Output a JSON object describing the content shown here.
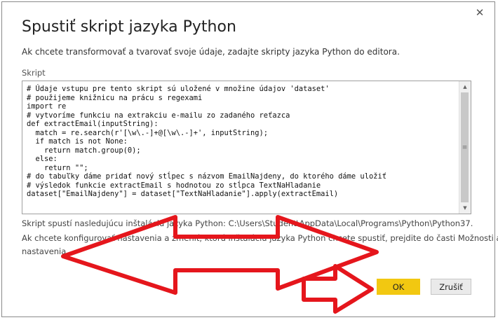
{
  "dialog": {
    "title": "Spustiť skript jazyka Python",
    "subtitle": "Ak chcete transformovať a tvarovať svoje údaje, zadajte skripty jazyka Python do editora.",
    "script_label": "Skript",
    "code_lines": [
      "# Údaje vstupu pre tento skript sú uložené v množine údajov 'dataset'",
      "# použijeme knižnicu na prácu s regexami",
      "import re",
      "# vytvoríme funkciu na extrakciu e-mailu zo zadaného reťazca",
      "def extractEmail(inputString):",
      "  match = re.search(r'[\\w\\.-]+@[\\w\\.-]+', inputString);",
      "  if match is not None:",
      "    return match.group(0);",
      "  else:",
      "    return \"\";",
      "# do tabuľky dáme pridať nový stĺpec s názvom EmailNajdeny, do ktorého dáme uložiť",
      "# výsledok funkcie extractEmail s hodnotou zo stĺpca TextNaHladanie",
      "dataset[\"EmailNajdeny\"] = dataset[\"TextNaHladanie\"].apply(extractEmail)"
    ],
    "info_line1": "Skript spustí nasledujúcu inštaláciu jazyka Python: C:\\Users\\Student\\AppData\\Local\\Programs\\Python\\Python37.",
    "info_line2": "Ak chcete konfigurovať nastavenia a zmeniť, ktorú inštaláciu jazyka Python chcete spustiť, prejdite do časti Možnosti a",
    "info_line3": "nastavenia.",
    "ok_label": "OK",
    "cancel_label": "Zrušiť",
    "close_icon": "close-icon"
  },
  "colors": {
    "ok_button": "#f2c811",
    "annotation_arrow": "#e5161c"
  }
}
